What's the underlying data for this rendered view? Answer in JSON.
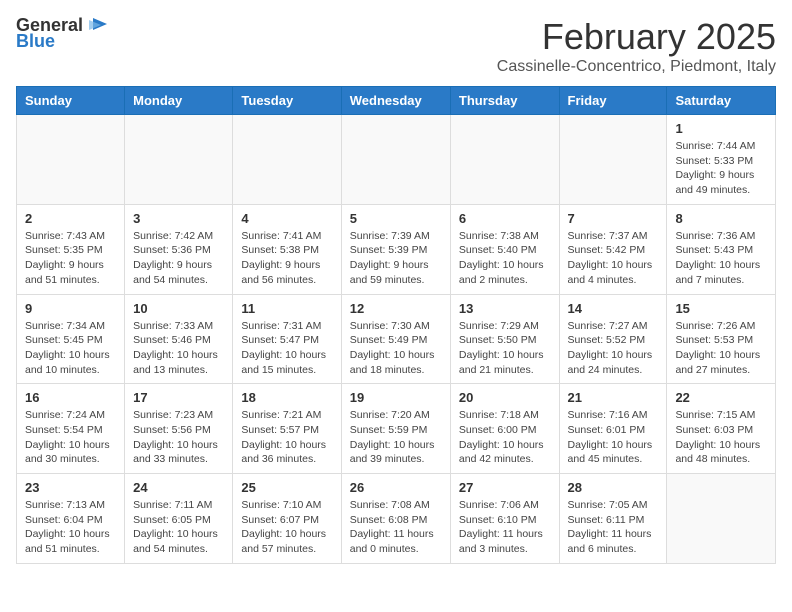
{
  "logo": {
    "general": "General",
    "blue": "Blue"
  },
  "title": "February 2025",
  "location": "Cassinelle-Concentrico, Piedmont, Italy",
  "weekdays": [
    "Sunday",
    "Monday",
    "Tuesday",
    "Wednesday",
    "Thursday",
    "Friday",
    "Saturday"
  ],
  "weeks": [
    [
      {
        "day": "",
        "info": ""
      },
      {
        "day": "",
        "info": ""
      },
      {
        "day": "",
        "info": ""
      },
      {
        "day": "",
        "info": ""
      },
      {
        "day": "",
        "info": ""
      },
      {
        "day": "",
        "info": ""
      },
      {
        "day": "1",
        "info": "Sunrise: 7:44 AM\nSunset: 5:33 PM\nDaylight: 9 hours\nand 49 minutes."
      }
    ],
    [
      {
        "day": "2",
        "info": "Sunrise: 7:43 AM\nSunset: 5:35 PM\nDaylight: 9 hours\nand 51 minutes."
      },
      {
        "day": "3",
        "info": "Sunrise: 7:42 AM\nSunset: 5:36 PM\nDaylight: 9 hours\nand 54 minutes."
      },
      {
        "day": "4",
        "info": "Sunrise: 7:41 AM\nSunset: 5:38 PM\nDaylight: 9 hours\nand 56 minutes."
      },
      {
        "day": "5",
        "info": "Sunrise: 7:39 AM\nSunset: 5:39 PM\nDaylight: 9 hours\nand 59 minutes."
      },
      {
        "day": "6",
        "info": "Sunrise: 7:38 AM\nSunset: 5:40 PM\nDaylight: 10 hours\nand 2 minutes."
      },
      {
        "day": "7",
        "info": "Sunrise: 7:37 AM\nSunset: 5:42 PM\nDaylight: 10 hours\nand 4 minutes."
      },
      {
        "day": "8",
        "info": "Sunrise: 7:36 AM\nSunset: 5:43 PM\nDaylight: 10 hours\nand 7 minutes."
      }
    ],
    [
      {
        "day": "9",
        "info": "Sunrise: 7:34 AM\nSunset: 5:45 PM\nDaylight: 10 hours\nand 10 minutes."
      },
      {
        "day": "10",
        "info": "Sunrise: 7:33 AM\nSunset: 5:46 PM\nDaylight: 10 hours\nand 13 minutes."
      },
      {
        "day": "11",
        "info": "Sunrise: 7:31 AM\nSunset: 5:47 PM\nDaylight: 10 hours\nand 15 minutes."
      },
      {
        "day": "12",
        "info": "Sunrise: 7:30 AM\nSunset: 5:49 PM\nDaylight: 10 hours\nand 18 minutes."
      },
      {
        "day": "13",
        "info": "Sunrise: 7:29 AM\nSunset: 5:50 PM\nDaylight: 10 hours\nand 21 minutes."
      },
      {
        "day": "14",
        "info": "Sunrise: 7:27 AM\nSunset: 5:52 PM\nDaylight: 10 hours\nand 24 minutes."
      },
      {
        "day": "15",
        "info": "Sunrise: 7:26 AM\nSunset: 5:53 PM\nDaylight: 10 hours\nand 27 minutes."
      }
    ],
    [
      {
        "day": "16",
        "info": "Sunrise: 7:24 AM\nSunset: 5:54 PM\nDaylight: 10 hours\nand 30 minutes."
      },
      {
        "day": "17",
        "info": "Sunrise: 7:23 AM\nSunset: 5:56 PM\nDaylight: 10 hours\nand 33 minutes."
      },
      {
        "day": "18",
        "info": "Sunrise: 7:21 AM\nSunset: 5:57 PM\nDaylight: 10 hours\nand 36 minutes."
      },
      {
        "day": "19",
        "info": "Sunrise: 7:20 AM\nSunset: 5:59 PM\nDaylight: 10 hours\nand 39 minutes."
      },
      {
        "day": "20",
        "info": "Sunrise: 7:18 AM\nSunset: 6:00 PM\nDaylight: 10 hours\nand 42 minutes."
      },
      {
        "day": "21",
        "info": "Sunrise: 7:16 AM\nSunset: 6:01 PM\nDaylight: 10 hours\nand 45 minutes."
      },
      {
        "day": "22",
        "info": "Sunrise: 7:15 AM\nSunset: 6:03 PM\nDaylight: 10 hours\nand 48 minutes."
      }
    ],
    [
      {
        "day": "23",
        "info": "Sunrise: 7:13 AM\nSunset: 6:04 PM\nDaylight: 10 hours\nand 51 minutes."
      },
      {
        "day": "24",
        "info": "Sunrise: 7:11 AM\nSunset: 6:05 PM\nDaylight: 10 hours\nand 54 minutes."
      },
      {
        "day": "25",
        "info": "Sunrise: 7:10 AM\nSunset: 6:07 PM\nDaylight: 10 hours\nand 57 minutes."
      },
      {
        "day": "26",
        "info": "Sunrise: 7:08 AM\nSunset: 6:08 PM\nDaylight: 11 hours\nand 0 minutes."
      },
      {
        "day": "27",
        "info": "Sunrise: 7:06 AM\nSunset: 6:10 PM\nDaylight: 11 hours\nand 3 minutes."
      },
      {
        "day": "28",
        "info": "Sunrise: 7:05 AM\nSunset: 6:11 PM\nDaylight: 11 hours\nand 6 minutes."
      },
      {
        "day": "",
        "info": ""
      }
    ]
  ]
}
